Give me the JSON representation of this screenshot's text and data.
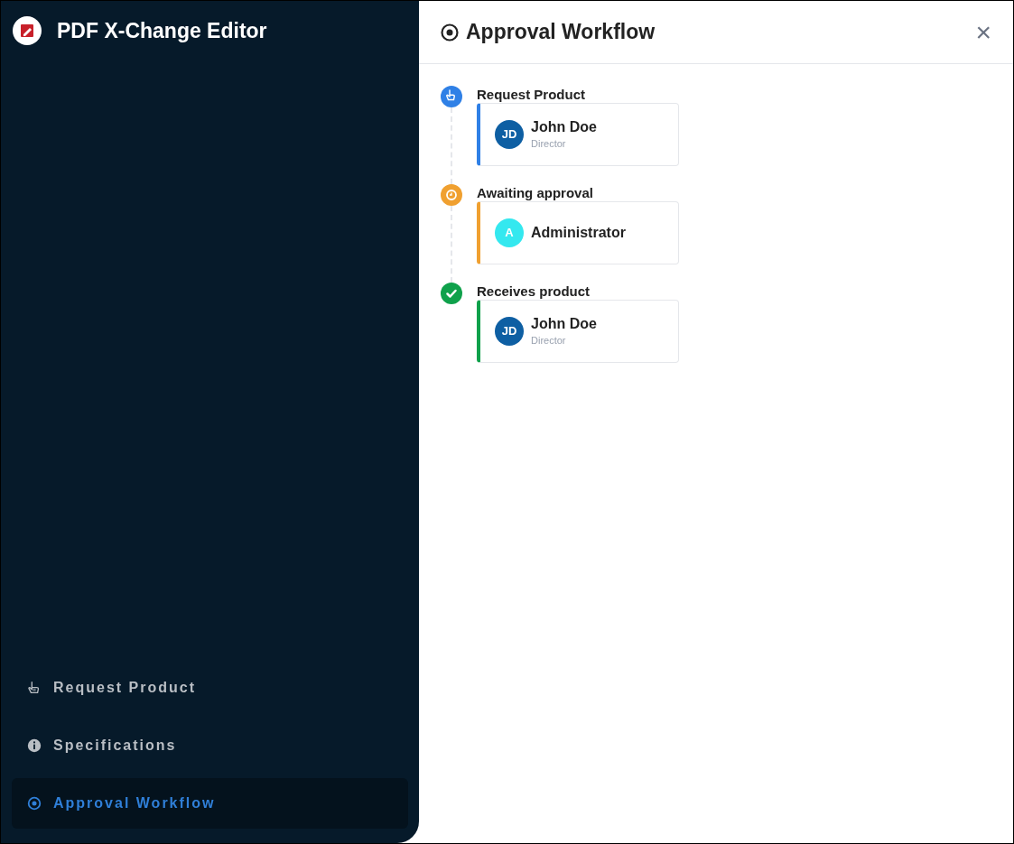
{
  "app": {
    "title": "PDF X-Change Editor"
  },
  "sidebar": {
    "items": [
      {
        "label": "Request Product",
        "kind": "hand",
        "selected": false
      },
      {
        "label": "Specifications",
        "kind": "info",
        "selected": false
      },
      {
        "label": "Approval Workflow",
        "kind": "target",
        "selected": true
      }
    ]
  },
  "panel": {
    "title": "Approval Workflow",
    "close": "×",
    "steps": [
      {
        "title": "Request Product",
        "kind": "hand",
        "color": "#2f80e6",
        "person": {
          "initials": "JD",
          "name": "John Doe",
          "role": "Director",
          "color": "#0e5fa3"
        }
      },
      {
        "title": "Awaiting approval",
        "kind": "clock",
        "color": "#f0a030",
        "person": {
          "initials": "A",
          "name": "Administrator",
          "color": "#34e8ef"
        }
      },
      {
        "title": "Receives product",
        "kind": "check",
        "color": "#0fa14b",
        "person": {
          "initials": "JD",
          "name": "John Doe",
          "role": "Director",
          "color": "#0e5fa3"
        }
      }
    ]
  }
}
